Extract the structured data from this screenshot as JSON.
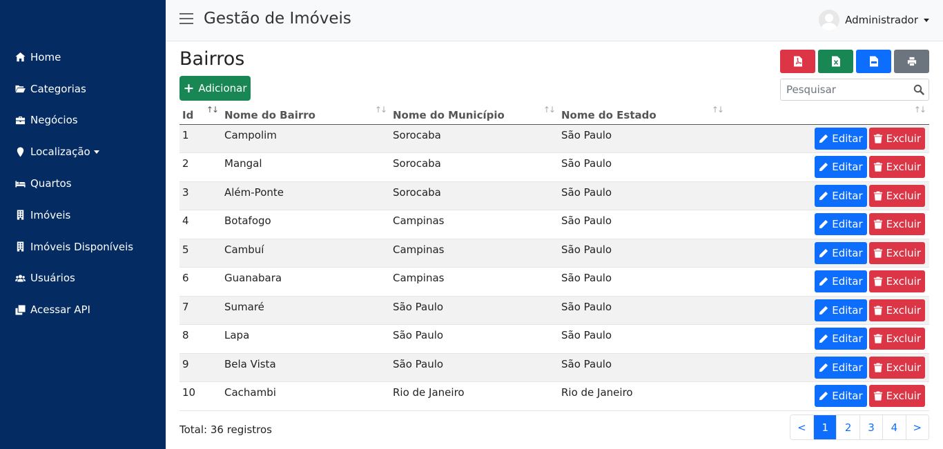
{
  "app": {
    "title": "Gestão de Imóveis"
  },
  "user": {
    "name": "Administrador"
  },
  "sidebar": {
    "items": [
      {
        "label": "Home",
        "icon": "home-icon"
      },
      {
        "label": "Categorias",
        "icon": "folder-open-icon"
      },
      {
        "label": "Negócios",
        "icon": "briefcase-icon"
      },
      {
        "label": "Localização",
        "icon": "map-marker-icon",
        "dropdown": true
      },
      {
        "label": "Quartos",
        "icon": "bed-icon"
      },
      {
        "label": "Imóveis",
        "icon": "building-icon"
      },
      {
        "label": "Imóveis Disponíveis",
        "icon": "building-icon"
      },
      {
        "label": "Usuários",
        "icon": "users-icon"
      },
      {
        "label": "Acessar API",
        "icon": "clone-icon"
      }
    ]
  },
  "page": {
    "title": "Bairros",
    "add_label": "Adicionar",
    "search_placeholder": "Pesquisar",
    "export_colors": {
      "pdf": "#dc3545",
      "excel": "#198754",
      "csv": "#0d6efd",
      "print": "#6c757d"
    }
  },
  "table": {
    "headers": [
      "Id",
      "Nome do Bairro",
      "Nome do Município",
      "Nome do Estado",
      ""
    ],
    "sort_active_column": 0,
    "edit_label": "Editar",
    "delete_label": "Excluir",
    "rows": [
      [
        "1",
        "Campolim",
        "Sorocaba",
        "São Paulo"
      ],
      [
        "2",
        "Mangal",
        "Sorocaba",
        "São Paulo"
      ],
      [
        "3",
        "Além-Ponte",
        "Sorocaba",
        "São Paulo"
      ],
      [
        "4",
        "Botafogo",
        "Campinas",
        "São Paulo"
      ],
      [
        "5",
        "Cambuí",
        "Campinas",
        "São Paulo"
      ],
      [
        "6",
        "Guanabara",
        "Campinas",
        "São Paulo"
      ],
      [
        "7",
        "Sumaré",
        "São Paulo",
        "São Paulo"
      ],
      [
        "8",
        "Lapa",
        "São Paulo",
        "São Paulo"
      ],
      [
        "9",
        "Bela Vista",
        "São Paulo",
        "São Paulo"
      ],
      [
        "10",
        "Cachambi",
        "Rio de Janeiro",
        "Rio de Janeiro"
      ]
    ]
  },
  "footer": {
    "total_text": "Total: 36 registros",
    "pagination": {
      "prev": "<",
      "pages": [
        "1",
        "2",
        "3",
        "4"
      ],
      "current": "1",
      "next": ">"
    }
  },
  "colors": {
    "sidebar_bg": "#042c63",
    "primary": "#0d6efd",
    "danger": "#dc3545",
    "success": "#198754"
  }
}
